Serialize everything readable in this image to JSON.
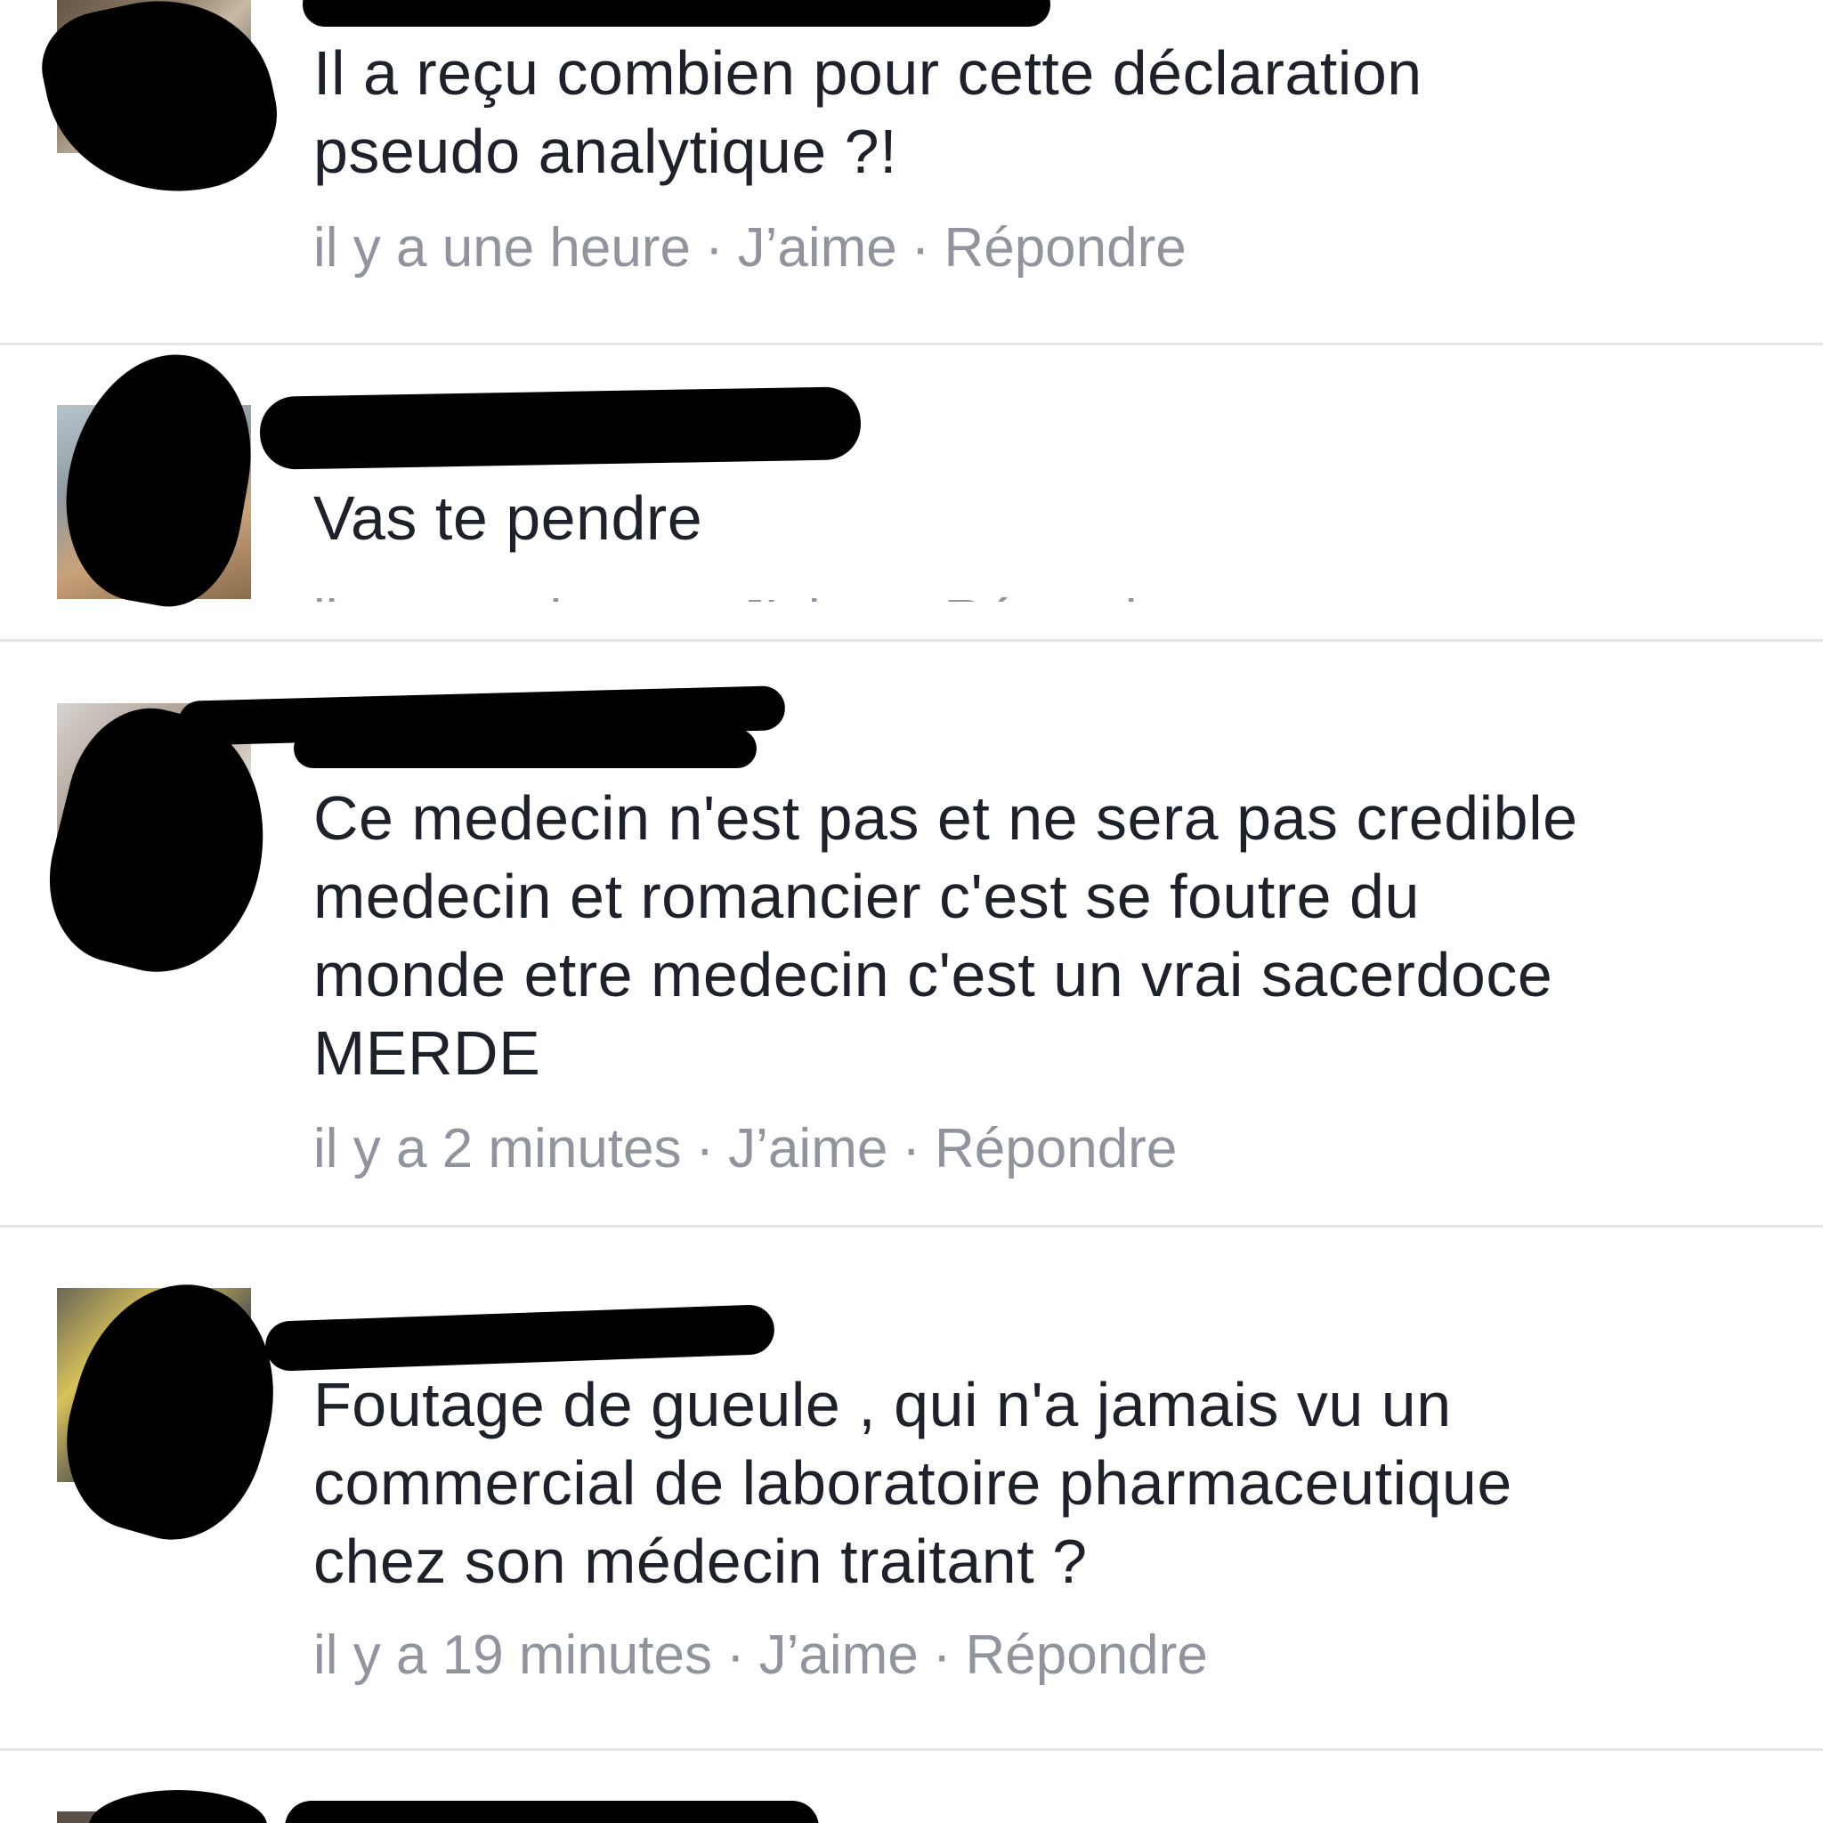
{
  "comments": [
    {
      "text": "Il a reçu combien pour cette déclaration\npseudo analytique ?!",
      "time": "il y a une heure",
      "like": "J’aime",
      "reply": "Répondre",
      "separator": "·"
    },
    {
      "text": "Vas te pendre",
      "time": "il y a une heure",
      "like": "J’aime",
      "reply": "Répondre",
      "separator": "·"
    },
    {
      "text": "Ce medecin n'est pas et ne sera pas credible\nmedecin et romancier c'est se foutre du\nmonde etre medecin c'est un vrai sacerdoce\nMERDE",
      "time": "il y a 2 minutes",
      "like": "J’aime",
      "reply": "Répondre",
      "separator": "·"
    },
    {
      "text": "Foutage de gueule , qui n'a jamais vu un\ncommercial de laboratoire pharmaceutique\nchez son médecin traitant ?",
      "time": "il y a 19 minutes",
      "like": "J’aime",
      "reply": "Répondre",
      "separator": "·"
    }
  ],
  "colors": {
    "text": "#1d2129",
    "meta": "#90949c",
    "divider": "#e3e4e8",
    "background": "#ffffff",
    "redaction": "#000000"
  }
}
